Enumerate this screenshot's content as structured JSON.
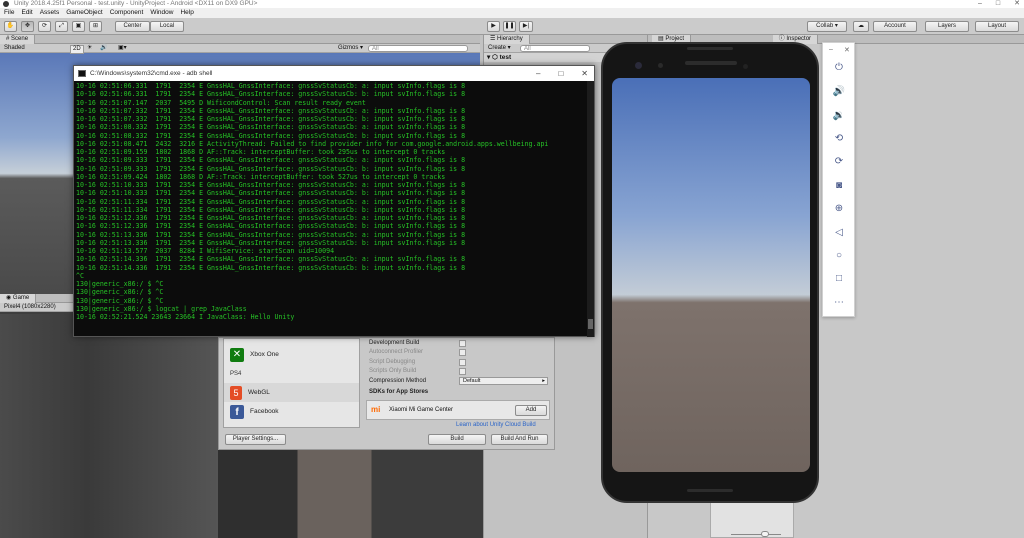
{
  "window": {
    "title": "Unity 2018.4.25f1 Personal - test.unity - UnityProject - Android <DX11 on DX9 GPU>"
  },
  "menu": [
    "File",
    "Edit",
    "Assets",
    "GameObject",
    "Component",
    "Window",
    "Help"
  ],
  "toolbar": {
    "center": "Center",
    "local": "Local",
    "collab": "Collab ▾",
    "account": "Account",
    "layers": "Layers",
    "layout": "Layout"
  },
  "scene": {
    "tab": "Scene",
    "shading": "Shaded",
    "mode2d": "2D",
    "gizmos": "Gizmos ▾",
    "search": "All"
  },
  "game": {
    "tab": "Game",
    "resolution": "Pixel4 (1080x2280)"
  },
  "hierarchy": {
    "tab": "Hierarchy",
    "create": "Create ▾",
    "search": "All",
    "root": "test"
  },
  "project": {
    "tab": "Project"
  },
  "inspector": {
    "tab": "Inspector"
  },
  "cmd": {
    "title": "C:\\Windows\\system32\\cmd.exe - adb  shell",
    "lines": [
      "10-16 02:51:06.331  1791  2354 E GnssHAL_GnssInterface: gnssSvStatusCb: a: input svInfo.flags is 8",
      "10-16 02:51:06.331  1791  2354 E GnssHAL_GnssInterface: gnssSvStatusCb: b: input svInfo.flags is 8",
      "10-16 02:51:07.147  2037  5495 D WificondControl: Scan result ready event",
      "10-16 02:51:07.332  1791  2354 E GnssHAL_GnssInterface: gnssSvStatusCb: a: input svInfo.flags is 8",
      "10-16 02:51:07.332  1791  2354 E GnssHAL_GnssInterface: gnssSvStatusCb: b: input svInfo.flags is 8",
      "10-16 02:51:08.332  1791  2354 E GnssHAL_GnssInterface: gnssSvStatusCb: a: input svInfo.flags is 8",
      "10-16 02:51:08.332  1791  2354 E GnssHAL_GnssInterface: gnssSvStatusCb: b: input svInfo.flags is 8",
      "10-16 02:51:08.471  2432  3216 E ActivityThread: Failed to find provider info for com.google.android.apps.wellbeing.api",
      "10-16 02:51:09.159  1802  1868 D AF::Track: interceptBuffer: took 295us to intercept 0 tracks",
      "10-16 02:51:09.333  1791  2354 E GnssHAL_GnssInterface: gnssSvStatusCb: a: input svInfo.flags is 8",
      "10-16 02:51:09.333  1791  2354 E GnssHAL_GnssInterface: gnssSvStatusCb: b: input svInfo.flags is 8",
      "10-16 02:51:09.424  1802  1868 D AF::Track: interceptBuffer: took 527us to intercept 0 tracks",
      "10-16 02:51:10.333  1791  2354 E GnssHAL_GnssInterface: gnssSvStatusCb: a: input svInfo.flags is 8",
      "10-16 02:51:10.333  1791  2354 E GnssHAL_GnssInterface: gnssSvStatusCb: b: input svInfo.flags is 8",
      "10-16 02:51:11.334  1791  2354 E GnssHAL_GnssInterface: gnssSvStatusCb: a: input svInfo.flags is 8",
      "10-16 02:51:11.334  1791  2354 E GnssHAL_GnssInterface: gnssSvStatusCb: b: input svInfo.flags is 8",
      "10-16 02:51:12.336  1791  2354 E GnssHAL_GnssInterface: gnssSvStatusCb: a: input svInfo.flags is 8",
      "10-16 02:51:12.336  1791  2354 E GnssHAL_GnssInterface: gnssSvStatusCb: b: input svInfo.flags is 8",
      "10-16 02:51:13.336  1791  2354 E GnssHAL_GnssInterface: gnssSvStatusCb: a: input svInfo.flags is 8",
      "10-16 02:51:13.336  1791  2354 E GnssHAL_GnssInterface: gnssSvStatusCb: b: input svInfo.flags is 8",
      "10-16 02:51:13.577  2037  8284 I WifiService: startScan uid=10094",
      "10-16 02:51:14.336  1791  2354 E GnssHAL_GnssInterface: gnssSvStatusCb: a: input svInfo.flags is 8",
      "10-16 02:51:14.336  1791  2354 E GnssHAL_GnssInterface: gnssSvStatusCb: b: input svInfo.flags is 8",
      "^C",
      "130|generic_x86:/ $ ^C",
      "130|generic_x86:/ $ ^C",
      "130|generic_x86:/ $ ^C",
      "130|generic_x86:/ $ logcat | grep JavaClass",
      "10-16 02:52:21.524 23643 23664 I JavaClass: Hello Unity"
    ]
  },
  "build": {
    "platforms": [
      "Xbox One",
      "PS4",
      "WebGL",
      "Facebook"
    ],
    "development_build": "Development Build",
    "autoconnect": "Autoconnect Profiler",
    "script_debugging": "Script Debugging",
    "scripts_only": "Scripts Only Build",
    "compression_label": "Compression Method",
    "compression_value": "Default",
    "sdk_heading": "SDKs for App Stores",
    "sdk_name": "Xiaomi Mi Game Center",
    "add": "Add",
    "cloud_link": "Learn about Unity Cloud Build",
    "player_settings": "Player Settings...",
    "build": "Build",
    "build_and_run": "Build And Run"
  },
  "colors": {
    "terminal_text": "#26c226",
    "xbox": "#107c10",
    "webgl": "#e44d26",
    "facebook": "#3b5998",
    "xiaomi": "#ff6900"
  }
}
